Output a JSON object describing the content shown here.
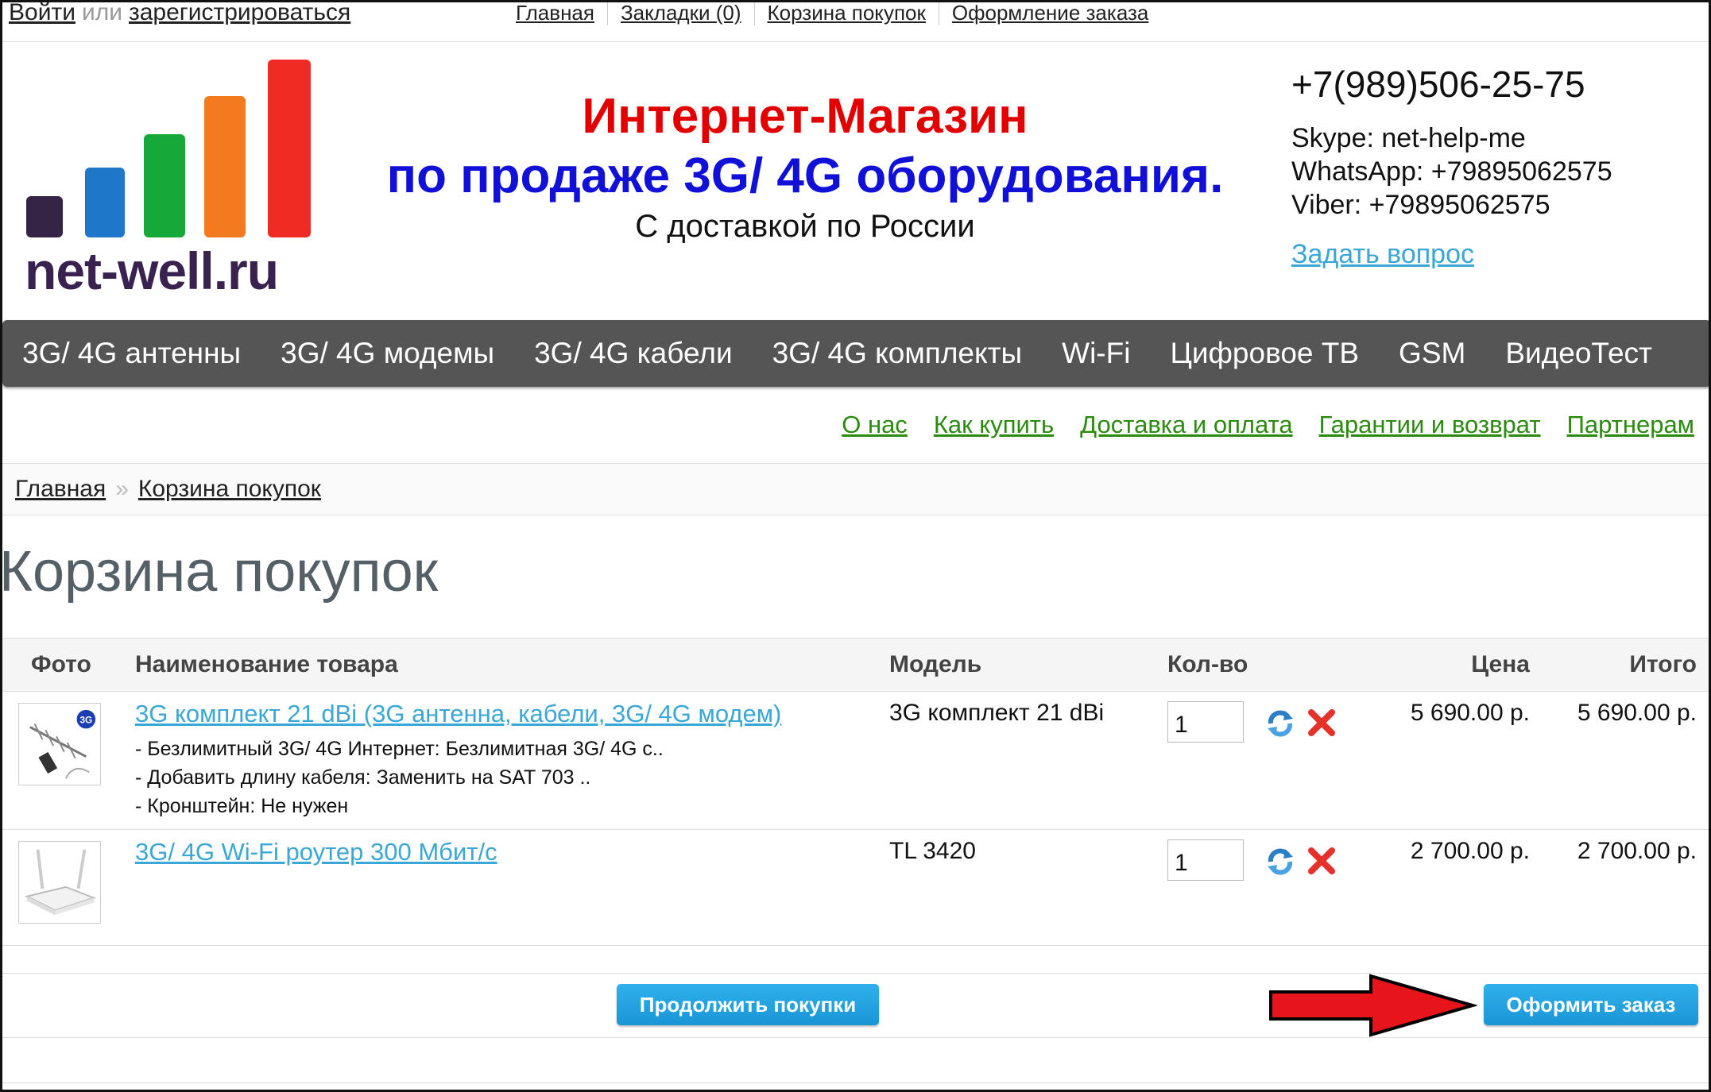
{
  "topbar": {
    "login": "Войти",
    "or": "или",
    "register": "зарегистрироваться",
    "links": [
      "Главная",
      "Закладки (0)",
      "Корзина покупок",
      "Оформление заказа"
    ]
  },
  "header": {
    "brand": "net-well.ru",
    "slogan_line1": "Интернет-Магазин",
    "slogan_line2": "по продаже 3G/ 4G оборудования.",
    "slogan_line3": "С доставкой по России",
    "phone": "+7(989)506-25-75",
    "skype": "Skype: net-help-me",
    "whatsapp": "WhatsApp: +79895062575",
    "viber": "Viber: +79895062575",
    "ask_link": "Задать вопрос",
    "logo_bar_colors": [
      "#352445",
      "#1e77c9",
      "#17a83a",
      "#f47a1f",
      "#ef2b24"
    ]
  },
  "menu": [
    "3G/ 4G антенны",
    "3G/ 4G модемы",
    "3G/ 4G кабели",
    "3G/ 4G комплекты",
    "Wi-Fi",
    "Цифровое ТВ",
    "GSM",
    "ВидеоТест"
  ],
  "info_links": [
    "О нас",
    "Как купить",
    "Доставка и оплата",
    "Гарантии и возврат",
    "Партнерам"
  ],
  "breadcrumb": {
    "home": "Главная",
    "separator": "»",
    "current": "Корзина покупок"
  },
  "page_title": "Корзина покупок",
  "cart": {
    "columns": {
      "photo": "Фото",
      "name": "Наименование товара",
      "model": "Модель",
      "qty": "Кол-во",
      "price": "Цена",
      "total": "Итого"
    },
    "items": [
      {
        "name": "3G комплект 21 dBi (3G антенна, кабели, 3G/ 4G модем)",
        "options": [
          "- Безлимитный 3G/ 4G Интернет: Безлимитная 3G/ 4G с..",
          "- Добавить длину кабеля: Заменить на SAT 703 ..",
          "- Кронштейн: Не нужен"
        ],
        "model": "3G комплект 21 dBi",
        "qty": "1",
        "price": "5 690.00 р.",
        "total": "5 690.00 р."
      },
      {
        "name": "3G/ 4G Wi-Fi роутер 300 Мбит/с",
        "options": [],
        "model": "TL 3420",
        "qty": "1",
        "price": "2 700.00 р.",
        "total": "2 700.00 р."
      }
    ]
  },
  "buttons": {
    "continue": "Продолжить покупки",
    "checkout": "Оформить заказ"
  },
  "colors": {
    "accent": "#1a95d6",
    "menu_bg": "#555555",
    "info_link": "#2b8b0f",
    "arrow": "#e8141c"
  }
}
